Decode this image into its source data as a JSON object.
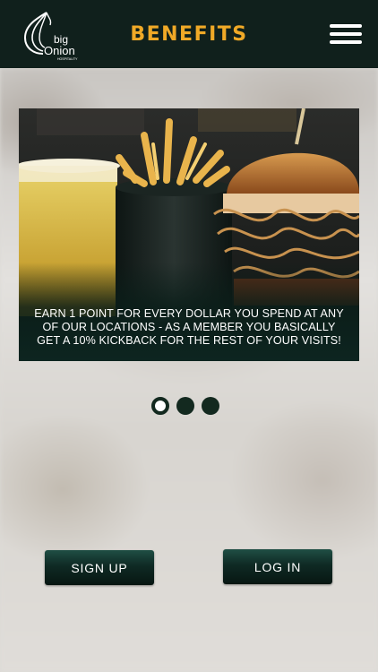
{
  "header": {
    "logo_text": "big Onion",
    "logo_sub": "HOSPITALITY",
    "title": "BENEFITS"
  },
  "carousel": {
    "active_index": 0,
    "slide_count": 3,
    "slide_text": "Earn 1 point for every dollar you spend at any of our locations - as a member you basically get a 10% kickback for the rest of your visits!"
  },
  "actions": {
    "signup_label": "SIGN UP",
    "login_label": "LOG IN"
  },
  "colors": {
    "header_bg": "#10201c",
    "accent": "#f0a927",
    "button": "#0f2a24"
  }
}
